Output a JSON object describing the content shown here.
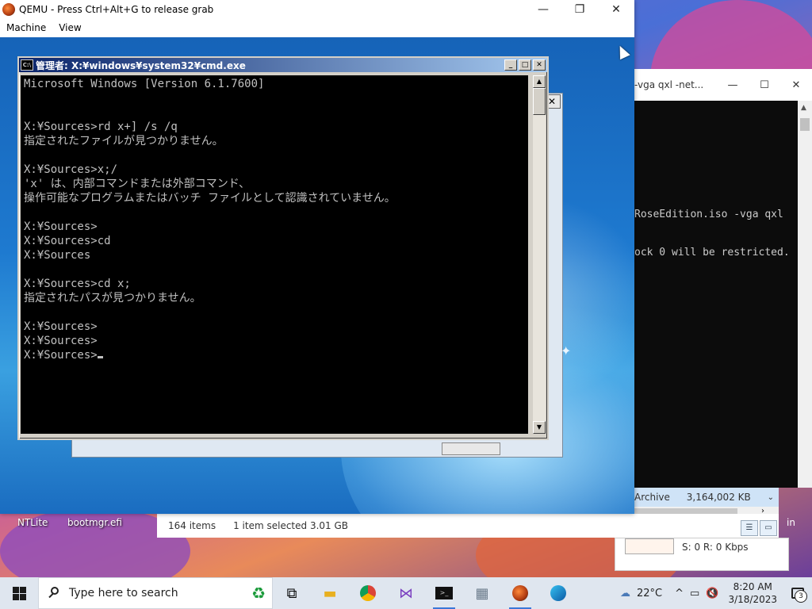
{
  "qemu": {
    "title": "QEMU - Press Ctrl+Alt+G to release grab",
    "menu": [
      "Machine",
      "View"
    ],
    "controls": {
      "minimize": "—",
      "maximize": "❐",
      "close": "✕"
    }
  },
  "cmd": {
    "title": "管理者: X:¥windows¥system32¥cmd.exe",
    "icon_text": "C:\\",
    "lines": [
      "Microsoft Windows [Version 6.1.7600]",
      "",
      "",
      "X:¥Sources>rd x+] /s /q",
      "指定されたファイルが見つかりません。",
      "",
      "X:¥Sources>x;/",
      "'x' は、内部コマンドまたは外部コマンド、",
      "操作可能なプログラムまたはバッチ ファイルとして認識されていません。",
      "",
      "X:¥Sources>",
      "X:¥Sources>cd",
      "X:¥Sources",
      "",
      "X:¥Sources>cd x;",
      "指定されたパスが見つかりません。",
      "",
      "X:¥Sources>",
      "X:¥Sources>",
      "X:¥Sources>"
    ]
  },
  "host_terminal": {
    "title": "-vga qxl -net...",
    "lines": [
      "RoseEdition.iso -vga qxl",
      "ock 0 will be restricted."
    ]
  },
  "explorer": {
    "item_count": "164 items",
    "selected": "1 item selected  3.01 GB",
    "archive_label": "Archive",
    "archive_size": "3,164,002 KB",
    "transfer": "S: 0 R: 0 Kbps",
    "partial_label": "in"
  },
  "desktop_icons": [
    "NTLite",
    "bootmgr.efi"
  ],
  "taskbar": {
    "search_placeholder": "Type here to search",
    "temperature": "22°C",
    "time": "8:20 AM",
    "date": "3/18/2023",
    "notification_count": "3",
    "apps": [
      "task-view-icon",
      "file-explorer-icon",
      "chrome-icon",
      "visual-studio-icon",
      "terminal-icon",
      "photos-icon",
      "qemu-icon",
      "edge-icon"
    ]
  },
  "colors": {
    "accent": "#3b78d8",
    "cmd_title_start": "#0a246a",
    "cmd_title_end": "#a6caf0",
    "console_text": "#c0c0c0"
  }
}
